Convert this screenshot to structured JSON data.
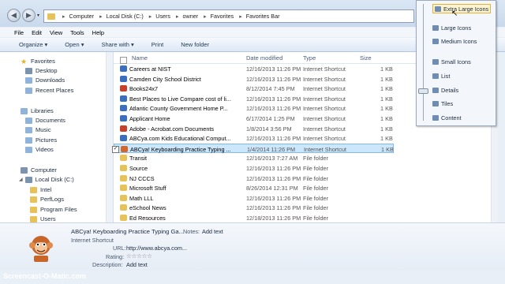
{
  "address": {
    "crumbs": [
      "Computer",
      "Local Disk (C:)",
      "Users",
      "owner",
      "Favorites",
      "Favorites Bar"
    ]
  },
  "menu": [
    "File",
    "Edit",
    "View",
    "Tools",
    "Help"
  ],
  "toolbar": {
    "organize": "Organize ▾",
    "open": "Open ▾",
    "share": "Share with ▾",
    "print": "Print",
    "new_folder": "New folder"
  },
  "nav": {
    "favorites": "Favorites",
    "fav_items": [
      "Desktop",
      "Downloads",
      "Recent Places"
    ],
    "libraries": "Libraries",
    "lib_items": [
      "Documents",
      "Music",
      "Pictures",
      "Videos"
    ],
    "computer": "Computer",
    "disk": "Local Disk (C:)",
    "folders": [
      "Intel",
      "PerfLogs",
      "Program Files",
      "Users"
    ]
  },
  "columns": {
    "name": "Name",
    "date": "Date modified",
    "type": "Type",
    "size": "Size"
  },
  "files": [
    {
      "name": "Careers at NIST",
      "date": "12/16/2013 11:26 PM",
      "type": "Internet Shortcut",
      "size": "1 KB",
      "color": "#3a6fbf"
    },
    {
      "name": "Camden City School District",
      "date": "12/16/2013 11:26 PM",
      "type": "Internet Shortcut",
      "size": "1 KB",
      "color": "#3a6fbf"
    },
    {
      "name": "Books24x7",
      "date": "8/12/2014 7:45 PM",
      "type": "Internet Shortcut",
      "size": "1 KB",
      "color": "#c8402a"
    },
    {
      "name": "Best Places to Live  Compare cost of li...",
      "date": "12/16/2013 11:26 PM",
      "type": "Internet Shortcut",
      "size": "1 KB",
      "color": "#3a6fbf"
    },
    {
      "name": "Atlantic County Government Home P...",
      "date": "12/16/2013 11:26 PM",
      "type": "Internet Shortcut",
      "size": "1 KB",
      "color": "#3a6fbf"
    },
    {
      "name": "Applicant Home",
      "date": "6/17/2014 1:25 PM",
      "type": "Internet Shortcut",
      "size": "1 KB",
      "color": "#3a6fbf"
    },
    {
      "name": "Adobe - Acrobat.com Documents",
      "date": "1/8/2014 3:56 PM",
      "type": "Internet Shortcut",
      "size": "1 KB",
      "color": "#c8402a"
    },
    {
      "name": "ABCya.com  Kids Educational Comput...",
      "date": "12/16/2013 11:26 PM",
      "type": "Internet Shortcut",
      "size": "1 KB",
      "color": "#3a6fbf"
    },
    {
      "name": "ABCya! Keyboarding Practice  Typing ...",
      "date": "1/4/2014 11:26 PM",
      "type": "Internet Shortcut",
      "size": "1 KB",
      "color": "#d4662a",
      "selected": true
    },
    {
      "name": "Transit",
      "date": "12/16/2013 7:27 AM",
      "type": "File folder",
      "size": "",
      "color": "#e7c259"
    },
    {
      "name": "Source",
      "date": "12/16/2013 11:26 PM",
      "type": "File folder",
      "size": "",
      "color": "#e7c259"
    },
    {
      "name": "NJ CCCS",
      "date": "12/16/2013 11:26 PM",
      "type": "File folder",
      "size": "",
      "color": "#e7c259"
    },
    {
      "name": "Microsoft Stuff",
      "date": "8/26/2014 12:31 PM",
      "type": "File folder",
      "size": "",
      "color": "#e7c259"
    },
    {
      "name": "Math LLL",
      "date": "12/16/2013 11:26 PM",
      "type": "File folder",
      "size": "",
      "color": "#e7c259"
    },
    {
      "name": "eSchool News",
      "date": "12/16/2013 11:26 PM",
      "type": "File folder",
      "size": "",
      "color": "#e7c259"
    },
    {
      "name": "Ed Resources",
      "date": "12/18/2013 11:26 PM",
      "type": "File folder",
      "size": "",
      "color": "#e7c259"
    }
  ],
  "details": {
    "title": "ABCya! Keyboarding Practice  Typing Ga...",
    "subtitle": "Internet Shortcut",
    "notes_label": "Notes:",
    "notes_value": "Add text",
    "url_label": "URL:",
    "url_value": "http://www.abcya.com...",
    "rating_label": "Rating:",
    "rating_value": "☆☆☆☆☆",
    "desc_label": "Description:",
    "desc_value": "Add text"
  },
  "view_menu": [
    "Extra Large Icons",
    "Large Icons",
    "Medium Icons",
    "Small Icons",
    "List",
    "Details",
    "Tiles",
    "Content"
  ],
  "watermark": "Screencast-O-Matic.com"
}
